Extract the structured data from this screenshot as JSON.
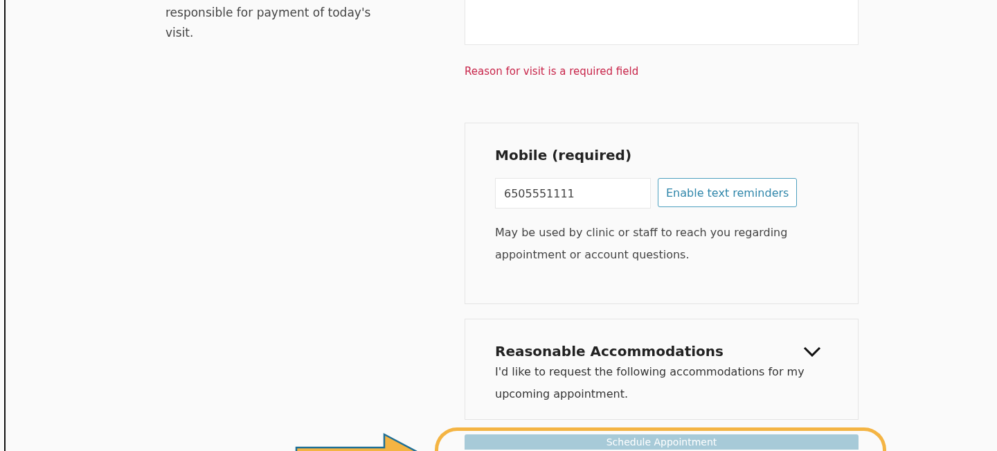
{
  "left_note": "responsible for payment of today's visit.",
  "reason_error": "Reason for visit is a required field",
  "mobile": {
    "title": "Mobile (required)",
    "value": "6505551111",
    "button": "Enable text reminders",
    "help": "May be used by clinic or staff to reach you regarding appointment or account questions."
  },
  "accommodations": {
    "title": "Reasonable Accommodations",
    "expanded": false,
    "description": "I'd like to request the following accommodations for my upcoming appointment."
  },
  "submit": {
    "label": "Schedule Appointment",
    "disabled": true
  },
  "annotation": {
    "kind": "highlight"
  }
}
